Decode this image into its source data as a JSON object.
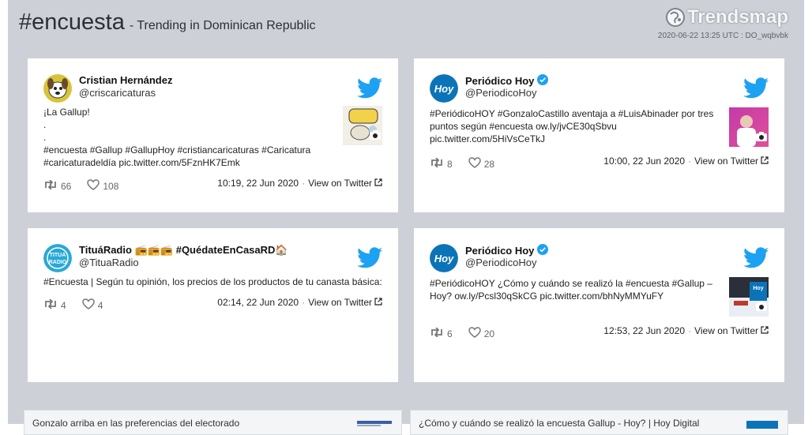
{
  "header": {
    "hashtag": "#encuesta",
    "subtitle": "- Trending in Dominican Republic",
    "logo_text": "Trendsmap",
    "timestamp": "2020-06-22 13:25 UTC : DO_wqbvbk"
  },
  "colors": {
    "background": "#cdd0d6",
    "twitter_blue": "#1da1f2",
    "hoy_blue": "#0b74b8"
  },
  "tweets": [
    {
      "name": "Cristian Hernández",
      "handle": "@criscaricaturas",
      "verified": false,
      "lines": [
        "¡La Gallup!",
        ".",
        ".",
        "#encuesta #Gallup #GallupHoy #cristiancaricaturas #Caricatura",
        "#caricaturadeldía pic.twitter.com/5FznHK7Emk"
      ],
      "retweets": "66",
      "likes": "108",
      "time": "10:19, 22 Jun 2020",
      "view_label": "View on Twitter",
      "has_photo": true
    },
    {
      "name": "Periódico Hoy",
      "handle": "@PeriodicoHoy",
      "verified": true,
      "lines": [
        "#PeriódicoHOY #GonzaloCastillo aventaja a #LuisAbinader por tres",
        "puntos según #encuesta ow.ly/jvCE30qSbvu",
        "pic.twitter.com/5HiVsCeTkJ"
      ],
      "retweets": "8",
      "likes": "28",
      "time": "10:00, 22 Jun 2020",
      "view_label": "View on Twitter",
      "has_photo": true
    },
    {
      "name": "TituáRadio 📻📻📻 #QuédateEnCasaRD🏠",
      "handle": "@TituaRadio",
      "verified": false,
      "lines": [
        "#Encuesta | Según tu opinión, los precios de los productos de tu canasta básica:"
      ],
      "retweets": "4",
      "likes": "4",
      "time": "02:14, 22 Jun 2020",
      "view_label": "View on Twitter",
      "has_photo": false
    },
    {
      "name": "Periódico Hoy",
      "handle": "@PeriodicoHoy",
      "verified": true,
      "lines": [
        "#PeriódicoHOY ¿Cómo y cuándo se realizó la #encuesta #Gallup –",
        "Hoy? ow.ly/Pcsl30qSkCG pic.twitter.com/bhNyMMYuFY"
      ],
      "retweets": "6",
      "likes": "20",
      "time": "12:53, 22 Jun 2020",
      "view_label": "View on Twitter",
      "has_photo": true
    }
  ],
  "links": [
    {
      "title": "Gonzalo arriba en las preferencias del electorado"
    },
    {
      "title": "¿Cómo y cuándo se realizó la encuesta Gallup - Hoy? | Hoy Digital"
    }
  ]
}
